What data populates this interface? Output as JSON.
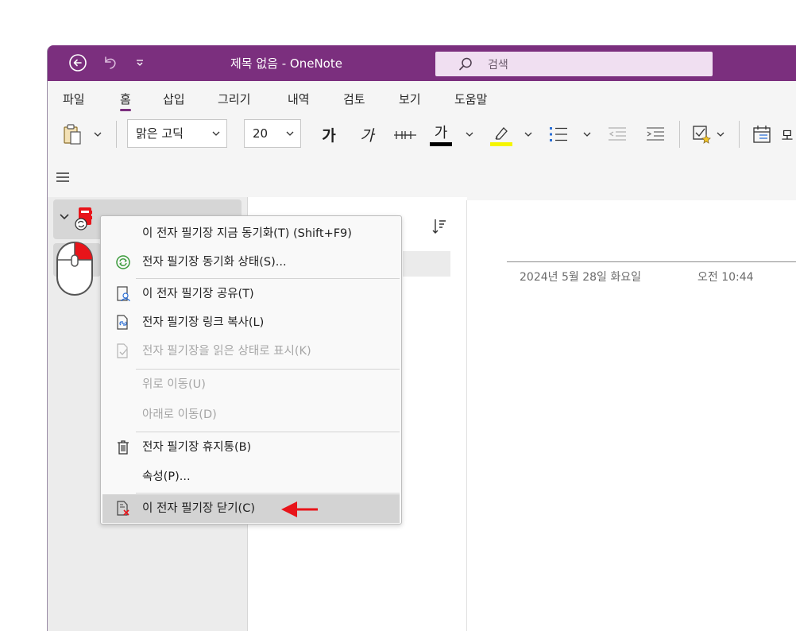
{
  "titlebar": {
    "title": "제목 없음  -  OneNote",
    "search_placeholder": "검색",
    "bg_color": "#7b2f7e"
  },
  "menu": {
    "items": [
      "파일",
      "홈",
      "삽입",
      "그리기",
      "내역",
      "검토",
      "보기",
      "도움말"
    ],
    "active_index": 1
  },
  "ribbon": {
    "font_name": "맑은 고딕",
    "font_size": "20",
    "bold_label": "가",
    "italic_label": "가",
    "strike_label": "가",
    "font_color_label": "가",
    "font_color": "#000000",
    "highlight_color": "#f5f500",
    "trailing_label": "모"
  },
  "page": {
    "date": "2024년 5월 28일 화요일",
    "time": "오전 10:44"
  },
  "context_menu": {
    "items": [
      {
        "label": "이 전자 필기장 지금 동기화(T)   (Shift+F9)",
        "icon": "none",
        "enabled": true
      },
      {
        "label": "전자 필기장 동기화 상태(S)...",
        "icon": "sync-status-icon",
        "enabled": true
      },
      {
        "label": "이 전자 필기장 공유(T)",
        "icon": "share-icon",
        "enabled": true
      },
      {
        "label": "전자 필기장 링크 복사(L)",
        "icon": "copy-link-icon",
        "enabled": true
      },
      {
        "label": "전자 필기장을 읽은 상태로 표시(K)",
        "icon": "mark-read-icon",
        "enabled": false
      },
      {
        "label": "위로 이동(U)",
        "icon": "none",
        "enabled": false
      },
      {
        "label": "아래로 이동(D)",
        "icon": "none",
        "enabled": false
      },
      {
        "label": "전자 필기장 휴지통(B)",
        "icon": "trash-icon",
        "enabled": true
      },
      {
        "label": "속성(P)...",
        "icon": "none",
        "enabled": true
      },
      {
        "label": "이 전자 필기장 닫기(C)",
        "icon": "close-notebook-icon",
        "enabled": true,
        "highlighted": true
      }
    ]
  },
  "annotation": {
    "arrow_color": "#e8141a",
    "mouse_button_color": "#e8141a"
  }
}
